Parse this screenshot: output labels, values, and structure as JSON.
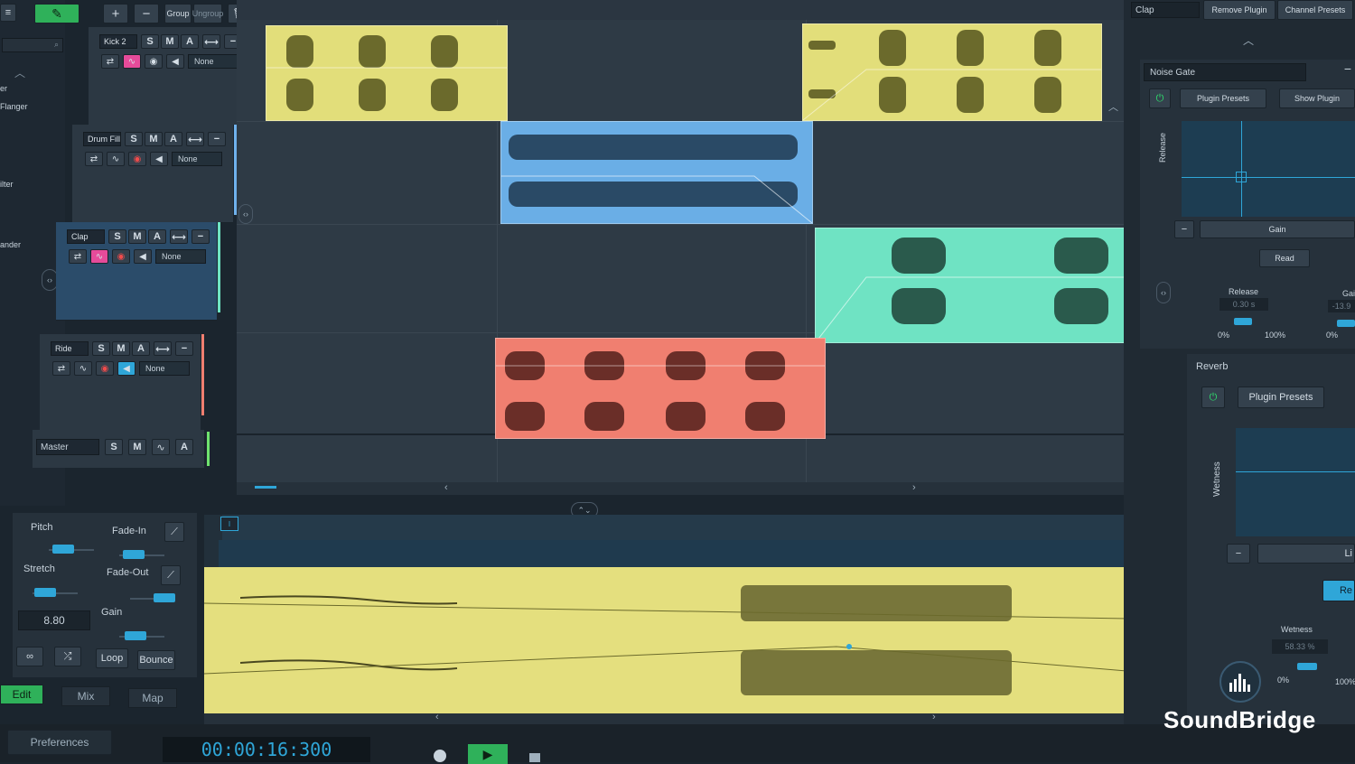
{
  "toolbar": {
    "group_label": "Group",
    "ungroup_label": "Ungroup"
  },
  "browser": {
    "items": [
      "er",
      "Flanger",
      "ilter",
      "ander"
    ]
  },
  "tracks": [
    {
      "name": "Kick 2",
      "output": "None",
      "color": "#e6e27a"
    },
    {
      "name": "Drum Fill",
      "output": "None",
      "color": "#6fb1ec"
    },
    {
      "name": "Clap",
      "output": "None",
      "color": "#6fe3c3"
    },
    {
      "name": "Ride",
      "output": "None",
      "color": "#f07f70"
    }
  ],
  "track_buttons": {
    "solo": "S",
    "mute": "M",
    "auto": "A"
  },
  "master": {
    "name": "Master",
    "solo": "S",
    "mute": "M",
    "auto": "A"
  },
  "clip_editor": {
    "pitch_label": "Pitch",
    "stretch_label": "Stretch",
    "stretch_value": "8.80",
    "fade_in_label": "Fade-In",
    "fade_out_label": "Fade-Out",
    "gain_label": "Gain",
    "loop_label": "Loop",
    "bounce_label": "Bounce"
  },
  "view_tabs": {
    "edit": "Edit",
    "mix": "Mix",
    "map": "Map"
  },
  "footer": {
    "preferences": "Preferences",
    "time": "00:00:16:300"
  },
  "plugin_panel": {
    "track_name": "Clap",
    "remove_plugin": "Remove Plugin",
    "channel_presets": "Channel Presets",
    "noise_gate": {
      "title": "Noise Gate",
      "plugin_presets": "Plugin Presets",
      "show_plugin": "Show Plugin",
      "y_axis": "Release",
      "x_axis": "Gain",
      "mode": "Read",
      "release_label": "Release",
      "release_value": "0.30 s",
      "gain_label": "Gain",
      "gain_value": "-13.9",
      "min": "0%",
      "max": "100%"
    },
    "reverb": {
      "title": "Reverb",
      "plugin_presets": "Plugin Presets",
      "y_axis": "Wetness",
      "x_axis": "Li",
      "mode": "Re",
      "wetness_label": "Wetness",
      "wetness_value": "58.33 %",
      "min": "0%",
      "max": "100%"
    }
  },
  "brand": {
    "name": "SoundBridge",
    "accent": "#2fa6d8"
  }
}
